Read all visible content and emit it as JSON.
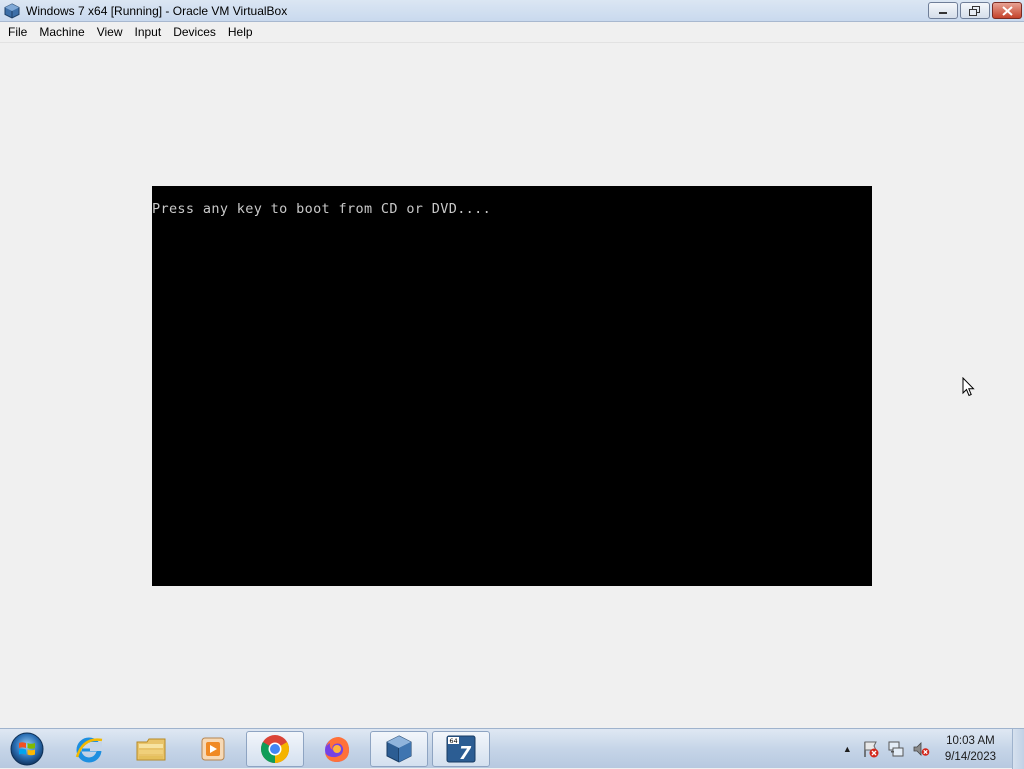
{
  "window": {
    "title": "Windows 7 x64 [Running] - Oracle VM VirtualBox",
    "app_icon": "virtualbox-icon",
    "controls": [
      "minimize-icon",
      "restore-icon",
      "close-icon"
    ]
  },
  "menubar": {
    "items": [
      "File",
      "Machine",
      "View",
      "Input",
      "Devices",
      "Help"
    ]
  },
  "vm": {
    "screen_text": "Press any key to boot from CD or DVD....",
    "background_color": "#000000",
    "text_color": "#c8c8c8"
  },
  "taskbar": {
    "start_icon": "windows-start-orb-icon",
    "pinned": [
      {
        "name": "internet-explorer-icon",
        "active": false
      },
      {
        "name": "file-explorer-icon",
        "active": false
      },
      {
        "name": "media-player-icon",
        "active": false
      },
      {
        "name": "chrome-icon",
        "active": true
      },
      {
        "name": "firefox-icon",
        "active": false
      },
      {
        "name": "virtualbox-icon",
        "active": true
      },
      {
        "name": "windows7-x64-vm-icon",
        "active": true
      }
    ],
    "tray": {
      "arrow": "▲",
      "icons": [
        "action-center-flag-icon",
        "network-icon",
        "volume-muted-icon"
      ],
      "time": "10:03 AM",
      "date": "9/14/2023"
    }
  }
}
